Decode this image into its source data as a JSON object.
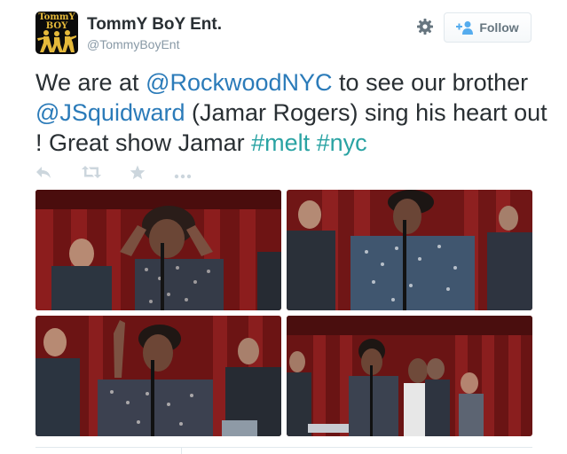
{
  "author": {
    "display_name": "TommY BoY Ent.",
    "handle": "@TommyBoyEnt",
    "avatar_logo_line1": "TommY",
    "avatar_logo_line2": "BOY"
  },
  "follow_button": {
    "label": "Follow",
    "icon": "follow-person-plus-icon"
  },
  "settings_icon": "gear-icon",
  "tweet": {
    "text_part1": "We are at ",
    "mention1": "@RockwoodNYC",
    "text_part2": " to see our brother ",
    "mention2": "@JSquidward",
    "text_part3": " (Jamar Rogers) sing his heart out ! Great show Jamar ",
    "hashtag1": "#melt",
    "text_part4": " ",
    "hashtag2": "#nyc"
  },
  "actions": [
    "reply-icon",
    "retweet-icon",
    "favorite-star-icon",
    "more-dots-icon"
  ],
  "photos": [
    "concert-photo-1",
    "concert-photo-2",
    "concert-photo-3",
    "concert-photo-4"
  ],
  "colors": {
    "text": "#292f33",
    "secondary": "#8899a6",
    "mention": "#2b7bb9",
    "hashtag": "#2aa3a3",
    "action_icon": "#ccd6dd",
    "border": "#e1e8ed"
  }
}
